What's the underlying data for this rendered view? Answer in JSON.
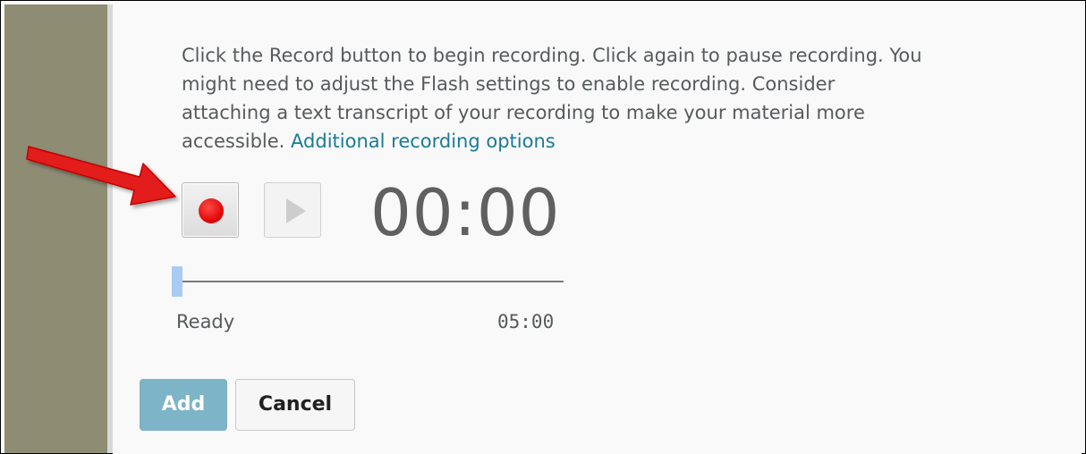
{
  "instructions": {
    "line1": "Click the Record button to begin recording. Click again to pause recording. You",
    "line2": "might need to adjust the Flash settings to enable recording. Consider",
    "line3": "attaching a text transcript of your recording to make your material more",
    "line4_prefix": "accessible. ",
    "link": "Additional recording options"
  },
  "recorder": {
    "record_icon": "record-dot",
    "play_icon": "play-triangle",
    "timer": "00:00",
    "status": "Ready",
    "max_duration": "05:00",
    "progress": 0
  },
  "actions": {
    "add_label": "Add",
    "cancel_label": "Cancel"
  },
  "colors": {
    "sidebar": "#8f8c74",
    "record": "#e00000",
    "link": "#1b7a96",
    "add_button": "#7db4c7",
    "annotation_arrow": "#e31c1c"
  }
}
